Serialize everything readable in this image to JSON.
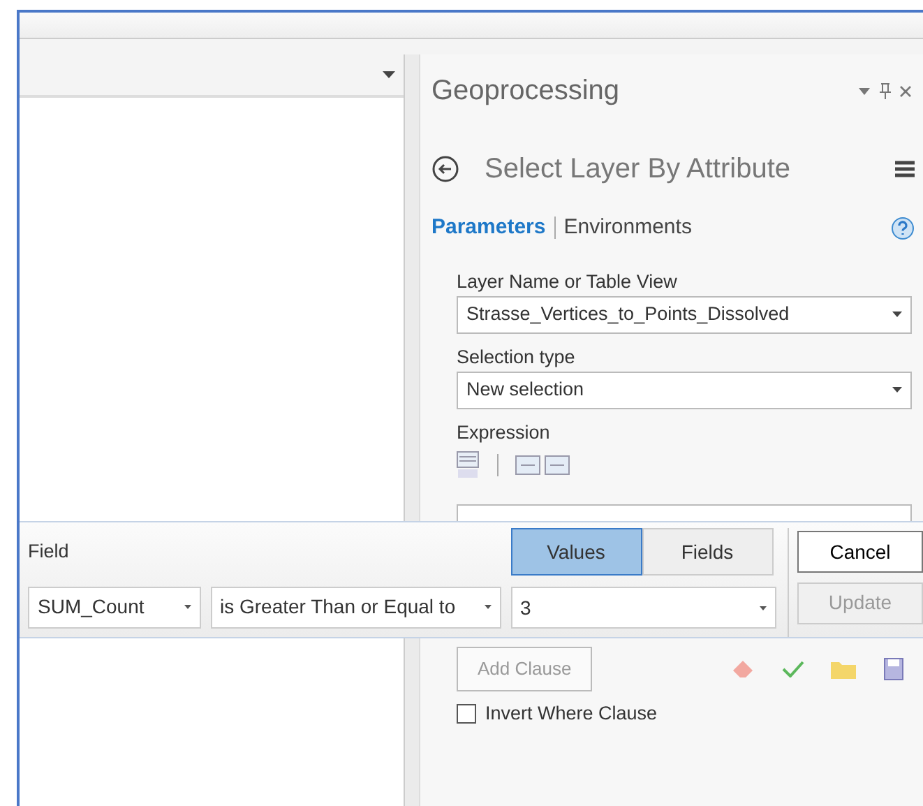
{
  "geoprocessing": {
    "title": "Geoprocessing",
    "tool_title": "Select Layer By Attribute",
    "tabs": [
      {
        "label": "Parameters",
        "selected": true
      },
      {
        "label": "Environments",
        "selected": false
      }
    ],
    "parameters": [
      {
        "label": "Layer Name or Table View",
        "value": "Strasse_Vertices_to_Points_Dissolved"
      },
      {
        "label": "Selection type",
        "value": "New selection"
      }
    ],
    "expression_label": "Expression",
    "add_clause": {
      "label": "Add Clause",
      "disabled": true
    },
    "invert_where_clause": {
      "label": "Invert Where Clause",
      "checked": false
    }
  },
  "clause_bar": {
    "field_label": "Field",
    "field": "SUM_Count",
    "operator": "is Greater Than or Equal to",
    "value": "3",
    "modes": [
      {
        "label": "Values",
        "selected": true
      },
      {
        "label": "Fields",
        "selected": false
      }
    ],
    "cancel": "Cancel",
    "update": {
      "label": "Update",
      "disabled": true
    }
  }
}
